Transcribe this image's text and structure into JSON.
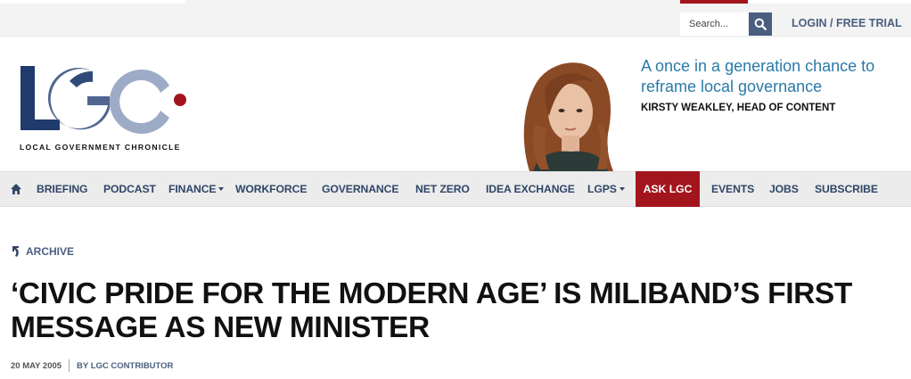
{
  "header": {
    "search_placeholder": "Search...",
    "login_label": "LOGIN / FREE TRIAL",
    "logo_text": "LGC",
    "logo_tagline": "LOCAL GOVERNMENT CHRONICLE"
  },
  "promo": {
    "title": "A once in a generation chance to reframe local governance",
    "author": "KIRSTY WEAKLEY, HEAD OF CONTENT"
  },
  "nav": {
    "items": [
      {
        "label": "BRIEFING"
      },
      {
        "label": "PODCAST"
      },
      {
        "label": "FINANCE"
      },
      {
        "label": "WORKFORCE"
      },
      {
        "label": "GOVERNANCE"
      },
      {
        "label": "NET ZERO"
      },
      {
        "label": "IDEA EXCHANGE"
      },
      {
        "label": "LGPS"
      },
      {
        "label": "ASK LGC"
      },
      {
        "label": "EVENTS"
      },
      {
        "label": "JOBS"
      },
      {
        "label": "SUBSCRIBE"
      }
    ]
  },
  "article": {
    "section": "ARCHIVE",
    "headline": "‘CIVIC PRIDE FOR THE MODERN AGE’ IS MILIBAND’S FIRST MESSAGE AS NEW MINISTER",
    "date": "20 MAY 2005",
    "byline": "BY LGC CONTRIBUTOR"
  },
  "colors": {
    "navy": "#2f4667",
    "slate": "#4a5e7f",
    "brand_red": "#a3151d",
    "promo_blue": "#2a7aa8",
    "logo_dark": "#1f3a6b",
    "logo_light": "#9eabc6"
  },
  "icons": {
    "search": "search-icon",
    "home": "home-icon",
    "archive": "archive-arrow-icon",
    "dropdown": "caret-down-icon"
  }
}
